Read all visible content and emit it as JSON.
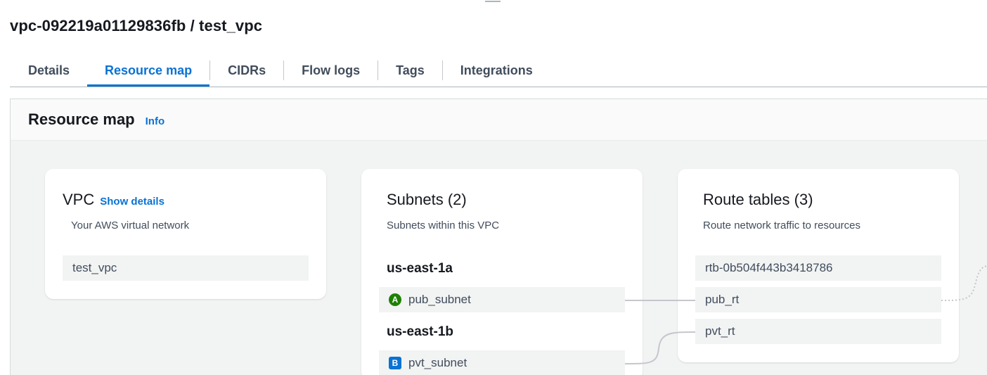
{
  "page": {
    "title": "vpc-092219a01129836fb / test_vpc"
  },
  "tabs": [
    {
      "label": "Details"
    },
    {
      "label": "Resource map"
    },
    {
      "label": "CIDRs"
    },
    {
      "label": "Flow logs"
    },
    {
      "label": "Tags"
    },
    {
      "label": "Integrations"
    }
  ],
  "active_tab": "Resource map",
  "resource_map": {
    "title": "Resource map",
    "info_label": "Info",
    "vpc": {
      "title": "VPC",
      "show_details_label": "Show details",
      "description": "Your AWS virtual network",
      "name": "test_vpc"
    },
    "subnets": {
      "title": "Subnets (2)",
      "description": "Subnets within this VPC",
      "zones": [
        {
          "name": "us-east-1a",
          "badge": "A",
          "subnet": "pub_subnet"
        },
        {
          "name": "us-east-1b",
          "badge": "B",
          "subnet": "pvt_subnet"
        }
      ]
    },
    "route_tables": {
      "title": "Route tables (3)",
      "description": "Route network traffic to resources",
      "items": [
        "rtb-0b504f443b3418786",
        "pub_rt",
        "pvt_rt"
      ]
    }
  },
  "colors": {
    "accent": "#0972d3",
    "badge_a": "#1d8102",
    "badge_b": "#0972d3"
  }
}
